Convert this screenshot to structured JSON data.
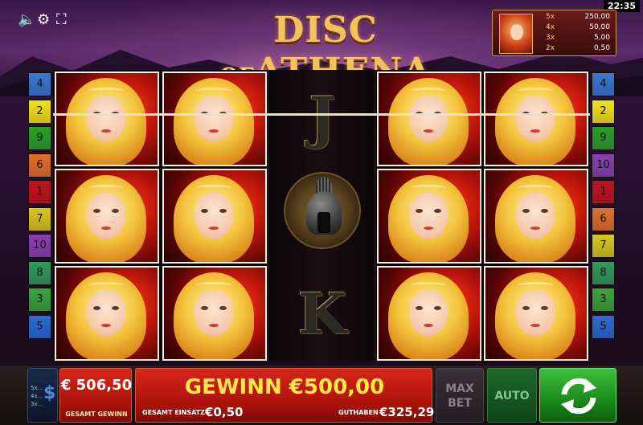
{
  "clock": "22:35",
  "top_controls": {
    "sound_icon": "speaker-icon",
    "settings_icon": "gear-icon",
    "fullscreen_icon": "fullscreen-icon"
  },
  "logo": {
    "part1": "DISC",
    "part2": "OF",
    "part3": "ATHENA"
  },
  "paytable": [
    {
      "mult": "5x",
      "value": "250,00"
    },
    {
      "mult": "4x",
      "value": "50,00"
    },
    {
      "mult": "3x",
      "value": "5,00"
    },
    {
      "mult": "2x",
      "value": "0,50"
    }
  ],
  "left_markers": [
    "4",
    "2",
    "9",
    "6",
    "1",
    "7",
    "10",
    "8",
    "3",
    "5"
  ],
  "right_markers": [
    "4",
    "2",
    "9",
    "10",
    "1",
    "6",
    "7",
    "8",
    "3",
    "5"
  ],
  "marker_colors": {
    "1": "#c0141a",
    "2": "#f4e21a",
    "3": "#3aa43a",
    "4": "#3a78d0",
    "5": "#2a6ad0",
    "6": "#e0702a",
    "7": "#d8c81a",
    "8": "#2f9a5a",
    "9": "#28a028",
    "10": "#8a40b0"
  },
  "reels": {
    "middle_symbols": [
      "J",
      "helmet",
      "K"
    ]
  },
  "stake_button": {
    "options": [
      "5x...",
      "4x...",
      "3x..."
    ],
    "icon": "dollar-icon"
  },
  "win_box": {
    "amount": "€ 506,50",
    "label": "GESAMT GEWINN"
  },
  "main_box": {
    "win_text": "GEWINN €500,00",
    "bet_label": "GESAMT EINSATZ",
    "bet_value": "€0,50",
    "balance_label": "GUTHABEN",
    "balance_value": "€325,29"
  },
  "max_bet": {
    "line1": "MAX",
    "line2": "BET"
  },
  "auto_label": "AUTO",
  "spin_icon": "spin-arrows-icon"
}
